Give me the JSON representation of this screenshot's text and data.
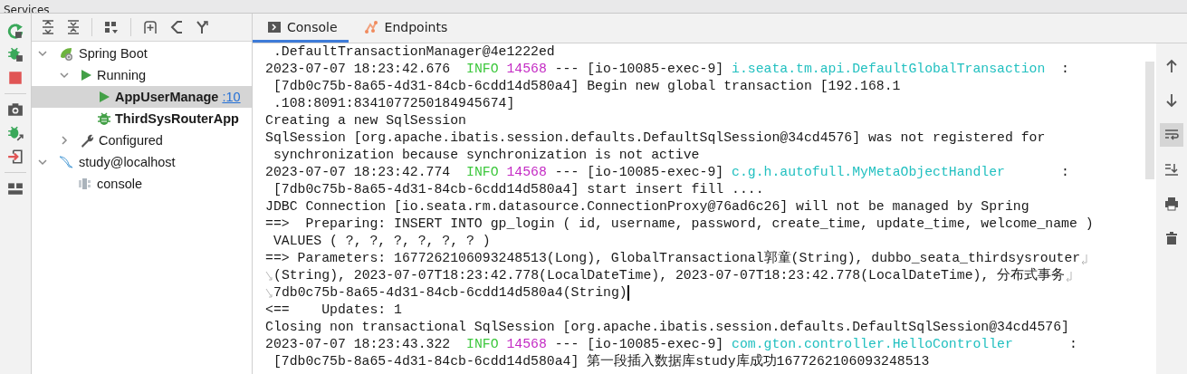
{
  "window": {
    "title": "Services"
  },
  "tree": [
    {
      "label": "Spring Boot",
      "kind": "spring",
      "expanded": true,
      "selected": false,
      "children": [
        {
          "label": "Running",
          "kind": "running",
          "expanded": true,
          "selected": false,
          "children": [
            {
              "label": "AppUserManage",
              "port": ":10",
              "kind": "app-run",
              "selected": true
            },
            {
              "label": "ThirdSysRouterApp",
              "kind": "app-debug",
              "selected": false
            }
          ]
        },
        {
          "label": "Configured",
          "kind": "configured",
          "expanded": false,
          "selected": false
        }
      ]
    },
    {
      "label": "study@localhost",
      "kind": "database",
      "expanded": true,
      "selected": false,
      "children": [
        {
          "label": "console",
          "kind": "console",
          "selected": false
        }
      ]
    }
  ],
  "tabs": [
    {
      "label": "Console",
      "kind": "console",
      "selected": true
    },
    {
      "label": "Endpoints",
      "kind": "endpoints",
      "selected": false
    }
  ],
  "console_toolbar": {
    "soft_wrap_on": true
  },
  "console_lines": [
    {
      "text": " .DefaultTransactionManager@4e1222ed"
    },
    {
      "segments": [
        {
          "kind": "plain",
          "text": "2023-07-07 18:23:42.676  "
        },
        {
          "kind": "level",
          "text": "INFO"
        },
        {
          "kind": "pid",
          "text": "14568"
        },
        {
          "kind": "plain",
          "text": " --- [io-10085-exec-9] "
        },
        {
          "kind": "logger",
          "text": "i.seata.tm.api.DefaultGlobalTransaction"
        },
        {
          "kind": "plain",
          "text": "  :"
        }
      ]
    },
    {
      "text": " [7db0c75b-8a65-4d31-84cb-6cdd14d580a4] Begin new global transaction [192.168.1"
    },
    {
      "text": " .108:8091:8341077250184945674]"
    },
    {
      "text": "Creating a new SqlSession"
    },
    {
      "text": "SqlSession [org.apache.ibatis.session.defaults.DefaultSqlSession@34cd4576] was not registered for"
    },
    {
      "text": " synchronization because synchronization is not active"
    },
    {
      "segments": [
        {
          "kind": "plain",
          "text": "2023-07-07 18:23:42.774  "
        },
        {
          "kind": "level",
          "text": "INFO"
        },
        {
          "kind": "pid",
          "text": "14568"
        },
        {
          "kind": "plain",
          "text": " --- [io-10085-exec-9] "
        },
        {
          "kind": "logger",
          "text": "c.g.h.autofull.MyMetaObjectHandler"
        },
        {
          "kind": "plain",
          "text": "       :"
        }
      ]
    },
    {
      "text": " [7db0c75b-8a65-4d31-84cb-6cdd14d580a4] start insert fill ...."
    },
    {
      "text": "JDBC Connection [io.seata.rm.datasource.ConnectionProxy@76ad6c26] will not be managed by Spring"
    },
    {
      "text": "==>  Preparing: INSERT INTO gp_login ( id, username, password, create_time, update_time, welcome_name )"
    },
    {
      "text": " VALUES ( ?, ?, ?, ?, ?, ? )"
    },
    {
      "text": "==> Parameters: 1677262106093248513(Long), GlobalTransactional郭童(String), dubbo_seata_thirdsysrouter",
      "wrap_end": true
    },
    {
      "text": "(String), 2023-07-07T18:23:42.778(LocalDateTime), 2023-07-07T18:23:42.778(LocalDateTime), 分布式事务",
      "continued": true,
      "wrap_end": true
    },
    {
      "text": "7db0c75b-8a65-4d31-84cb-6cdd14d580a4(String)",
      "continued": true,
      "caret": true
    },
    {
      "text": "<==    Updates: 1"
    },
    {
      "text": "Closing non transactional SqlSession [org.apache.ibatis.session.defaults.DefaultSqlSession@34cd4576]"
    },
    {
      "segments": [
        {
          "kind": "plain",
          "text": "2023-07-07 18:23:43.322  "
        },
        {
          "kind": "level",
          "text": "INFO"
        },
        {
          "kind": "pid",
          "text": "14568"
        },
        {
          "kind": "plain",
          "text": " --- [io-10085-exec-9] "
        },
        {
          "kind": "logger",
          "text": "com.gton.controller.HelloController"
        },
        {
          "kind": "plain",
          "text": "       :"
        }
      ]
    },
    {
      "text": " [7db0c75b-8a65-4d31-84cb-6cdd14d580a4] 第一段插入数据库study库成功1677262106093248513"
    }
  ]
}
